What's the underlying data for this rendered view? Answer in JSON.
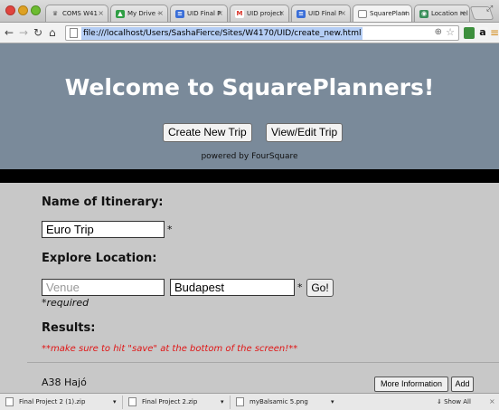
{
  "browser": {
    "tabs": [
      {
        "label": "COMS W41",
        "icon": "columbia-icon",
        "color": "#5a5a5a"
      },
      {
        "label": "My Drive -",
        "icon": "drive-icon",
        "color": "#2f9e44"
      },
      {
        "label": "UID Final P",
        "icon": "docs-icon",
        "color": "#3b6fd8"
      },
      {
        "label": "UID project",
        "icon": "gmail-icon",
        "color": "#d93025"
      },
      {
        "label": "UID Final P",
        "icon": "docs-icon",
        "color": "#3b6fd8"
      },
      {
        "label": "SquarePlann",
        "icon": "page-icon",
        "color": "#ffffff"
      },
      {
        "label": "Location rel",
        "icon": "location-icon",
        "color": "#3a8f5a"
      }
    ],
    "url": "file:///localhost/Users/SashaFierce/Sites/W4170/UID/create_new.html"
  },
  "header": {
    "title": "Welcome to SquarePlanners!",
    "create_label": "Create New Trip",
    "view_label": "View/Edit Trip",
    "powered": "powered by FourSquare"
  },
  "form": {
    "itinerary_label": "Name of Itinerary:",
    "itinerary_value": "Euro Trip",
    "explore_label": "Explore Location:",
    "venue_placeholder": "Venue",
    "location_value": "Budapest",
    "asterisk": "*",
    "go_label": "Go!",
    "required_note": "*required"
  },
  "results": {
    "label": "Results:",
    "warning": "**make sure to hit \"save\" at the bottom of the screen!**",
    "items": [
      {
        "name": "A38 Hajó",
        "info_label": "More Information",
        "add_label": "Add"
      }
    ]
  },
  "downloads": {
    "items": [
      {
        "name": "Final Project 2 (1).zip"
      },
      {
        "name": "Final Project 2.zip"
      },
      {
        "name": "myBalsamic 5.png"
      }
    ],
    "show_all": "Show All",
    "close": "×"
  }
}
